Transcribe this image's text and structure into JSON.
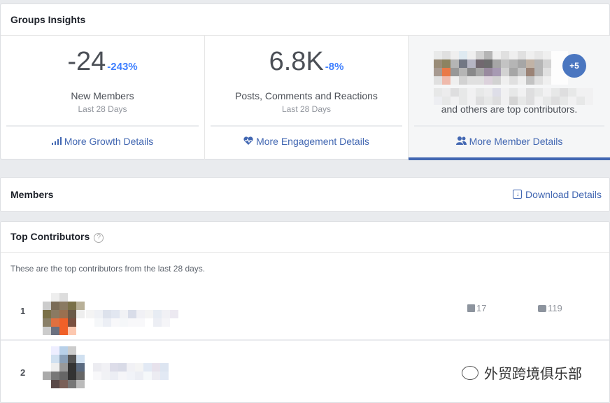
{
  "insights": {
    "title": "Groups Insights",
    "growth": {
      "value": "-24",
      "change": "-243%",
      "label": "New Members",
      "period": "Last 28 Days",
      "link": "More Growth Details",
      "icon": "bar-chart-icon"
    },
    "engagement": {
      "value": "6.8K",
      "change": "-8%",
      "label": "Posts, Comments and Reactions",
      "period": "Last 28 Days",
      "link": "More Engagement Details",
      "icon": "heart-pulse-icon"
    },
    "members": {
      "more_count": "+5",
      "text": "and others are top contributors.",
      "link": "More Member Details",
      "icon": "people-icon"
    }
  },
  "members_card": {
    "title": "Members",
    "download": "Download Details"
  },
  "contributors": {
    "title": "Top Contributors",
    "description": "These are the top contributors from the last 28 days.",
    "rows": [
      {
        "rank": "1",
        "posts": "17",
        "comments": "119"
      },
      {
        "rank": "2"
      }
    ]
  },
  "watermark": "外贸跨境俱乐部",
  "colors": {
    "accent": "#4267b2",
    "change": "#4080ff"
  }
}
